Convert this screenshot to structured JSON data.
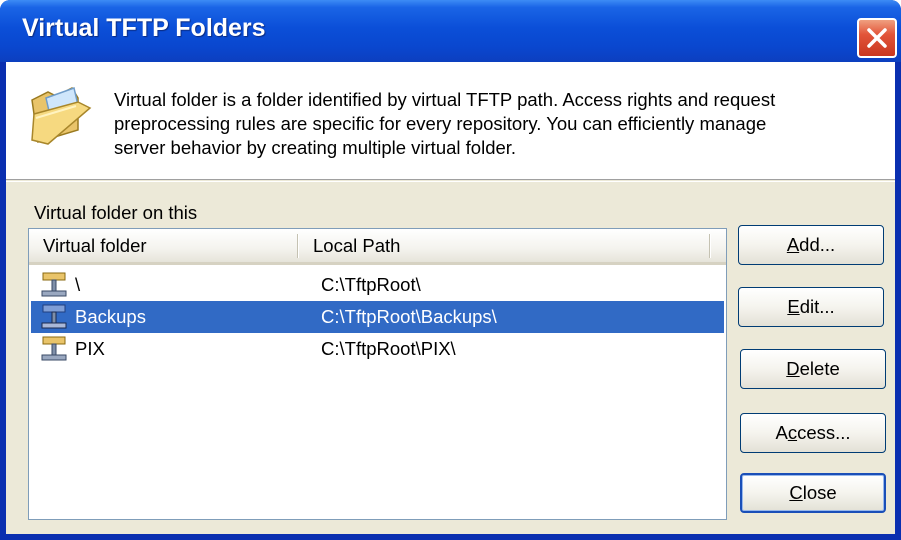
{
  "window": {
    "title": "Virtual TFTP Folders"
  },
  "header": {
    "description_lines": [
      "Virtual folder is a folder identified by virtual TFTP path. Access rights and request",
      "preprocessing rules are specific for every repository. You can efficiently manage",
      "server behavior by creating multiple virtual folder."
    ],
    "icon": "open-folder-icon"
  },
  "group": {
    "label": "Virtual folder on this"
  },
  "list": {
    "columns": [
      "Virtual folder",
      "Local Path"
    ],
    "rows": [
      {
        "name": "\\",
        "path": "C:\\TftpRoot\\",
        "selected": false
      },
      {
        "name": "Backups",
        "path": "C:\\TftpRoot\\Backups\\",
        "selected": true
      },
      {
        "name": "PIX",
        "path": "C:\\TftpRoot\\PIX\\",
        "selected": false
      }
    ],
    "row_icon": "network-share-icon"
  },
  "buttons": {
    "add": {
      "mnemonic": "A",
      "rest": "dd..."
    },
    "edit": {
      "mnemonic": "E",
      "rest": "dit..."
    },
    "delete": {
      "mnemonic": "D",
      "rest": "elete"
    },
    "access": {
      "pre": "A",
      "mnemonic": "c",
      "rest": "cess..."
    },
    "close": {
      "mnemonic": "C",
      "rest": "lose"
    }
  },
  "colors": {
    "titlebar": "#0b4fd8",
    "selection": "#316ac5",
    "dialog_face": "#ece9d8",
    "close_button": "#e2553a"
  }
}
